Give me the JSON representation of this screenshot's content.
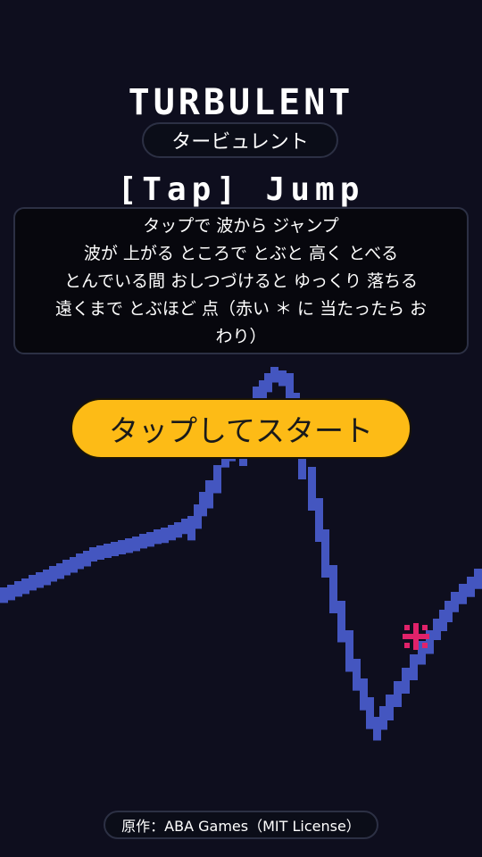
{
  "game": {
    "title": "TURBULENT",
    "subtitle": "タービュレント",
    "how_to": "[Tap] Jump",
    "instructions": [
      "タップで 波から ジャンプ",
      "波が 上がる ところで とぶと 高く とべる",
      "とんでいる間 おしつづけると ゆっくり 落ちる",
      "遠くまで とぶほど 点（赤い ＊ に 当たったら お",
      "わり）"
    ],
    "start_button": "タップしてスタート",
    "credit": "原作：ABA Games（MIT License）"
  },
  "colors": {
    "background": "#0e0e1e",
    "wave": "#4456c0",
    "hazard": "#e0226a",
    "button": "#fdbb16",
    "text": "#ffffff"
  },
  "icons": {
    "hazard": "red-asterisk-icon"
  }
}
